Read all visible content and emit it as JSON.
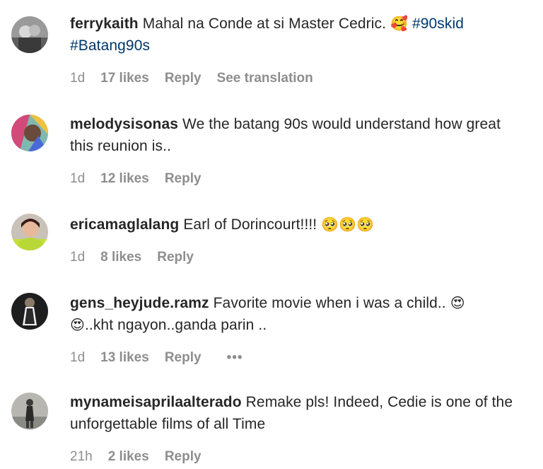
{
  "comments": [
    {
      "username": "ferrykaith",
      "text": "Mahal na Conde at si Master Cedric.",
      "emoji": "🥰",
      "hashtags": [
        "#90skid",
        "#Batang90s"
      ],
      "time": "1d",
      "likes": "17 likes",
      "reply": "Reply",
      "translate": "See translation"
    },
    {
      "username": "melodysisonas",
      "text": "We the batang 90s would understand how great this reunion is..",
      "time": "1d",
      "likes": "12 likes",
      "reply": "Reply"
    },
    {
      "username": "ericamaglalang",
      "text": "Earl of Dorincourt!!!!",
      "emoji": "🥺🥺🥺",
      "time": "1d",
      "likes": "8 likes",
      "reply": "Reply"
    },
    {
      "username": "gens_heyjude.ramz",
      "text": "Favorite movie when i was a child..",
      "emoji": "😍",
      "emoji2": "😍",
      "text2": "..kht ngayon..ganda parin ..",
      "time": "1d",
      "likes": "13 likes",
      "reply": "Reply",
      "more": "•••"
    },
    {
      "username": "mynameisaprilaalterado",
      "text": "Remake pls! Indeed, Cedie is one of the unforgettable films of all Time",
      "time": "21h",
      "likes": "2 likes",
      "reply": "Reply"
    }
  ],
  "avatars": [
    "user-avatar-ferrykaith",
    "user-avatar-melodysisonas",
    "user-avatar-ericamaglalang",
    "user-avatar-gens-heyjude-ramz",
    "user-avatar-mynameisaprilaalterado"
  ]
}
